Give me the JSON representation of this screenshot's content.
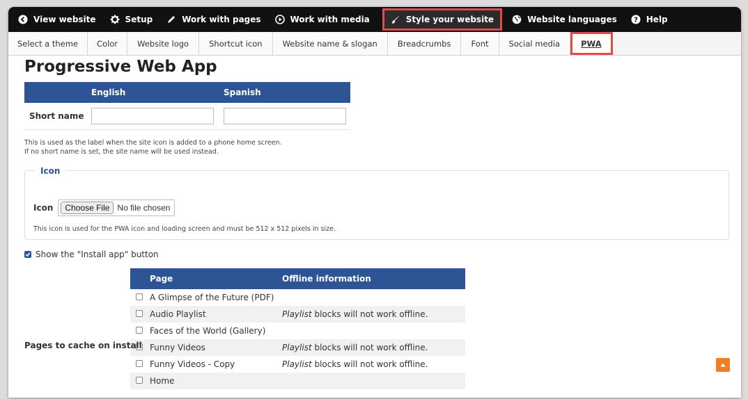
{
  "topbar": {
    "items": [
      {
        "label": "View website",
        "icon": "circle-arrow-left-icon"
      },
      {
        "label": "Setup",
        "icon": "gear-icon"
      },
      {
        "label": "Work with pages",
        "icon": "pencil-icon"
      },
      {
        "label": "Work with media",
        "icon": "play-circle-icon"
      },
      {
        "label": "Style your website",
        "icon": "paintbrush-icon"
      },
      {
        "label": "Website languages",
        "icon": "globe-icon"
      },
      {
        "label": "Help",
        "icon": "question-circle-icon"
      }
    ]
  },
  "tabs": [
    "Select a theme",
    "Color",
    "Website logo",
    "Shortcut icon",
    "Website name & slogan",
    "Breadcrumbs",
    "Font",
    "Social media",
    "PWA"
  ],
  "page_title": "Progressive Web App",
  "names_table": {
    "col_english": "English",
    "col_spanish": "Spanish",
    "row_label": "Short name",
    "english_value": "",
    "spanish_value": ""
  },
  "short_name_help": {
    "line1": "This is used as the label when the site icon is added to a phone home screen.",
    "line2": "If no short name is set, the site name will be used instead."
  },
  "icon_section": {
    "legend": "Icon",
    "label": "Icon",
    "button": "Choose File",
    "status": "No file chosen",
    "help": "This icon is used for the PWA icon and loading screen and must be 512 x 512 pixels in size."
  },
  "install_app": {
    "label": "Show the \"Install app\" button",
    "checked": true
  },
  "cache": {
    "label": "Pages to cache on install",
    "col_page": "Page",
    "col_offline": "Offline information",
    "rows": [
      {
        "page": "A Glimpse of the Future (PDF)",
        "em": "",
        "info": ""
      },
      {
        "page": "Audio Playlist",
        "em": "Playlist",
        "info": " blocks will not work offline."
      },
      {
        "page": "Faces of the World (Gallery)",
        "em": "",
        "info": ""
      },
      {
        "page": "Funny Videos",
        "em": "Playlist",
        "info": " blocks will not work offline."
      },
      {
        "page": "Funny Videos - Copy",
        "em": "Playlist",
        "info": " blocks will not work offline."
      },
      {
        "page": "Home",
        "em": "",
        "info": ""
      }
    ]
  },
  "colors": {
    "accent": "#2d5596",
    "highlight": "#e14b4b",
    "scroll_button": "#f07f22"
  }
}
